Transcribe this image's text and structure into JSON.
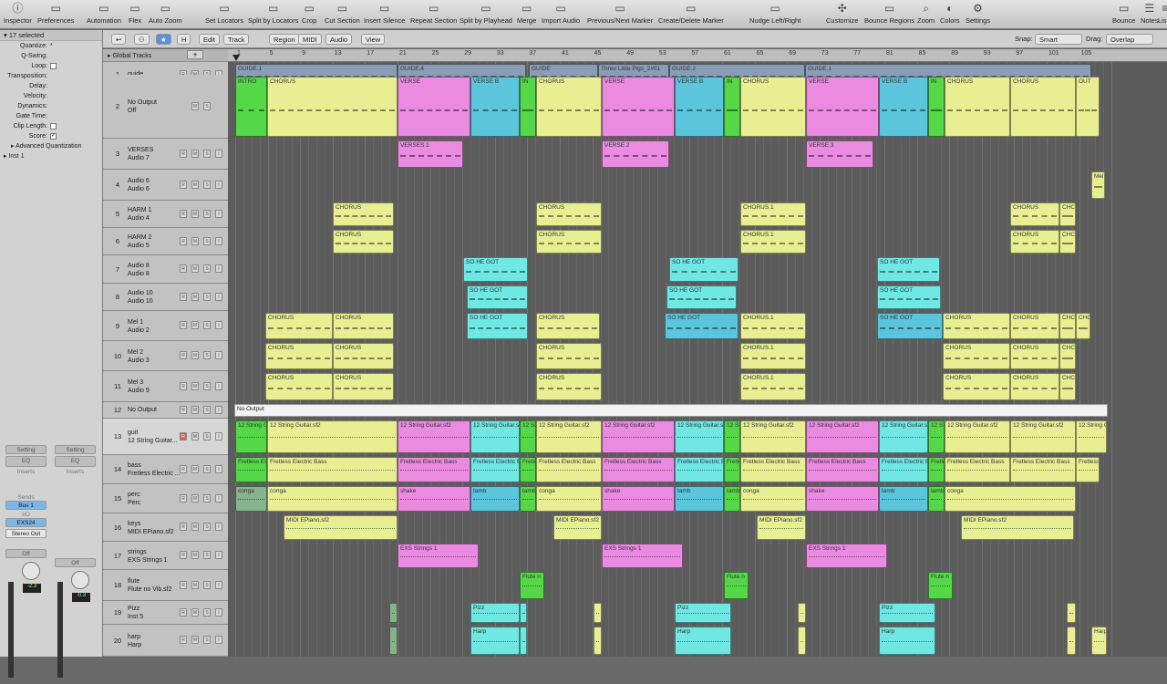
{
  "toolbar": {
    "buttons": [
      {
        "label": "Inspector",
        "icon": "info-icon"
      },
      {
        "label": "Preferences",
        "icon": "preferences-icon"
      },
      {
        "label": "Automation",
        "icon": "automation-icon"
      },
      {
        "label": "Flex",
        "icon": "flex-icon"
      },
      {
        "label": "Auto Zoom",
        "icon": "zoom-icon"
      },
      {
        "label": "Set Locators",
        "icon": "locators-icon"
      },
      {
        "label": "Split by Locators",
        "icon": "split-locators-icon"
      },
      {
        "label": "Crop",
        "icon": "crop-icon"
      },
      {
        "label": "Cut Section",
        "icon": "cut-icon"
      },
      {
        "label": "Insert Silence",
        "icon": "insert-silence-icon"
      },
      {
        "label": "Repeat Section",
        "icon": "repeat-icon"
      },
      {
        "label": "Split by Playhead",
        "icon": "split-playhead-icon"
      },
      {
        "label": "Merge",
        "icon": "merge-icon"
      },
      {
        "label": "Import Audio",
        "icon": "import-icon"
      },
      {
        "label": "Previous/Next Marker",
        "icon": "marker-nav-icon"
      },
      {
        "label": "Create/Delete Marker",
        "icon": "marker-icon"
      },
      {
        "label": "Nudge Left/Right",
        "icon": "nudge-icon"
      },
      {
        "label": "Customize",
        "icon": "customize-icon"
      },
      {
        "label": "Bounce Regions",
        "icon": "bounce-regions-icon"
      },
      {
        "label": "Zoom",
        "icon": "magnifier-icon"
      },
      {
        "label": "Colors",
        "icon": "colors-icon"
      },
      {
        "label": "Settings",
        "icon": "settings-icon"
      },
      {
        "label": "Bounce",
        "icon": "bounce-icon"
      },
      {
        "label": "Notes",
        "icon": "notes-icon"
      },
      {
        "label": "Lists",
        "icon": "lists-icon"
      }
    ]
  },
  "inspector": {
    "selection": "17 selected",
    "quant_rows": [
      {
        "label": "Quantize:",
        "value": "*"
      },
      {
        "label": "Q-Swing:",
        "value": ""
      },
      {
        "label": "Loop:",
        "value": "checkbox"
      },
      {
        "label": "Transposition:",
        "value": ""
      },
      {
        "label": "Delay:",
        "value": ""
      },
      {
        "label": "Velocity:",
        "value": ""
      },
      {
        "label": "Dynamics:",
        "value": ""
      },
      {
        "label": "Gate Time:",
        "value": ""
      },
      {
        "label": "Clip Length:",
        "value": "checkbox"
      },
      {
        "label": "Score:",
        "value": "checked"
      }
    ],
    "advanced": "Advanced Quantization",
    "inst": "Inst 1",
    "strip1": {
      "setting": "Setting",
      "eq": "EQ",
      "inserts": "Inserts",
      "sends": "Sends",
      "bus": "Bus 1",
      "io": "I/O",
      "input": "EXS24",
      "output": "Stereo Out",
      "auto": "Off",
      "meter": "-2.3"
    },
    "strip2": {
      "setting": "Setting",
      "eq": "EQ",
      "inserts": "Inserts",
      "auto": "Off",
      "meter": "-0.3"
    }
  },
  "menubar": {
    "menus": [
      "Edit",
      "Track",
      "Region",
      "MIDI",
      "Audio",
      "View"
    ],
    "snap_label": "Snap:",
    "snap_value": "Smart",
    "drag_label": "Drag:",
    "drag_value": "Overlap"
  },
  "global_tracks": "Global Tracks",
  "ruler": [
    "1",
    "5",
    "9",
    "13",
    "17",
    "21",
    "25",
    "29",
    "33",
    "37",
    "41",
    "45",
    "49",
    "53",
    "57",
    "61",
    "65",
    "69",
    "73",
    "77",
    "81",
    "85",
    "89",
    "93",
    "97",
    "101",
    "105"
  ],
  "tracks": [
    {
      "num": "1",
      "name": "guide",
      "sub": ""
    },
    {
      "num": "2",
      "name": "No Output",
      "sub": "Off"
    },
    {
      "num": "3",
      "name": "VERSES",
      "sub": "Audio 7"
    },
    {
      "num": "4",
      "name": "Audio 6",
      "sub": "Audio 6"
    },
    {
      "num": "5",
      "name": "HARM 1",
      "sub": "Audio 4"
    },
    {
      "num": "6",
      "name": "HARM 2",
      "sub": "Audio 5"
    },
    {
      "num": "7",
      "name": "Audio 8",
      "sub": "Audio 8"
    },
    {
      "num": "8",
      "name": "Audio 10",
      "sub": "Audio 10"
    },
    {
      "num": "9",
      "name": "Mel 1",
      "sub": "Audio 2"
    },
    {
      "num": "10",
      "name": "Mel 2",
      "sub": "Audio 3"
    },
    {
      "num": "11",
      "name": "Mel 3",
      "sub": "Audio 9"
    },
    {
      "num": "12",
      "name": "No Output",
      "sub": ""
    },
    {
      "num": "13",
      "name": "guit",
      "sub": "12 String Guitar..."
    },
    {
      "num": "14",
      "name": "bass",
      "sub": "Fretless Electric ..."
    },
    {
      "num": "15",
      "name": "perc",
      "sub": "Perc"
    },
    {
      "num": "16",
      "name": "keys",
      "sub": "MIDI EPiano.sf2"
    },
    {
      "num": "17",
      "name": "strings",
      "sub": "EXS Strings 1"
    },
    {
      "num": "18",
      "name": "flute",
      "sub": "Flute no Vib.sf2"
    },
    {
      "num": "19",
      "name": "Pizz",
      "sub": "Inst 5"
    },
    {
      "num": "20",
      "name": "harp",
      "sub": "Harp"
    }
  ],
  "regions": {
    "guide": [
      "GUIDE.1",
      "GUIDE.4",
      "GUIDE",
      "Three Little Pigs_2#01",
      "GUIDE.2",
      "GUIDE.1"
    ],
    "arrangement": [
      "INTRO",
      "CHORUS",
      "VERSE",
      "VERSE B",
      "IN",
      "CHORUS",
      "VERSE",
      "VERSE B",
      "IN",
      "CHORUS",
      "VERSE",
      "VERSE B",
      "IN",
      "CHORUS",
      "CHORUS",
      "OUT"
    ],
    "verses": [
      "VERSES 1",
      "VERSE 2",
      "VERSE 3"
    ],
    "audio6": [
      "Mel"
    ],
    "harm1": [
      "CHORUS",
      "CHORUS",
      "CHORUS.1",
      "CHORUS",
      "CHC"
    ],
    "harm2": [
      "CHORUS",
      "CHORUS",
      "CHORUS.1",
      "CHORUS",
      "CHC"
    ],
    "audio8": [
      "SO HE GOT",
      "SO HE GOT",
      "SO HE GOT"
    ],
    "audio10": [
      "SO HE GOT",
      "SO HE GOT",
      "SO HE GOT"
    ],
    "mel1": [
      "CHORUS",
      "CHORUS",
      "SO HE GOT",
      "CHORUS",
      "SO HE GOT",
      "CHORUS.1",
      "SO HE GOT",
      "CHORUS",
      "CHORUS",
      "CHC",
      "CHC"
    ],
    "mel2": [
      "CHORUS",
      "CHORUS",
      "CHORUS",
      "CHORUS.1",
      "CHORUS",
      "CHORUS",
      "CHC"
    ],
    "mel3": [
      "CHORUS",
      "CHORUS",
      "CHORUS",
      "CHORUS.1",
      "CHORUS",
      "CHORUS",
      "CHC"
    ],
    "folder": "No Output",
    "guit": "12 String Guitar.sf2",
    "bass": "Fretless Electric Bass",
    "perc": [
      "conga",
      "conga",
      "shake",
      "tamb",
      "tamb",
      "conga",
      "shake",
      "tamb",
      "tamb",
      "conga",
      "shake",
      "tamb",
      "tamb",
      "conga"
    ],
    "keys": "MIDI EPiano.sf2",
    "strings": "EXS Strings 1",
    "flute": "Flute n",
    "pizz": "Pizz",
    "harp": "Harp"
  }
}
